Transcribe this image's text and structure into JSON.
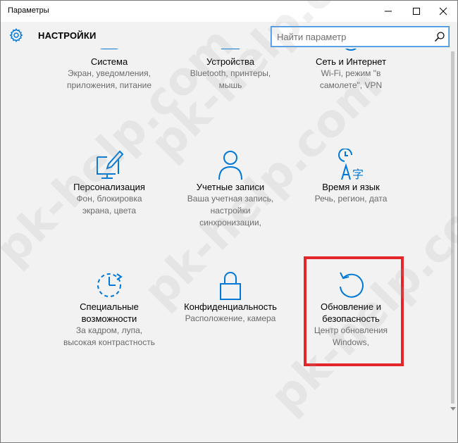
{
  "window": {
    "title": "Параметры"
  },
  "header": {
    "title": "НАСТРОЙКИ"
  },
  "search": {
    "placeholder": "Найти параметр"
  },
  "tiles": [
    {
      "name": "Система",
      "desc_lines": [
        "Экран, уведомления,",
        "приложения, питание"
      ],
      "icon": "system-icon"
    },
    {
      "name": "Устройства",
      "desc_lines": [
        "Bluetooth, принтеры,",
        "мышь"
      ],
      "icon": "devices-icon"
    },
    {
      "name": "Сеть и Интернет",
      "desc_lines": [
        "Wi-Fi, режим \"в",
        "самолете\", VPN"
      ],
      "icon": "network-icon"
    },
    {
      "name": "Персонализация",
      "desc_lines": [
        "Фон, блокировка",
        "экрана, цвета"
      ],
      "icon": "personalization-icon"
    },
    {
      "name": "Учетные записи",
      "desc_lines": [
        "Ваша учетная запись,",
        "настройки",
        "синхронизации,"
      ],
      "icon": "accounts-icon"
    },
    {
      "name": "Время и язык",
      "desc_lines": [
        "Речь, регион, дата"
      ],
      "icon": "time-language-icon"
    },
    {
      "name_lines": [
        "Специальные",
        "возможности"
      ],
      "desc_lines": [
        "За кадром, лупа,",
        "высокая контрастность"
      ],
      "icon": "ease-of-access-icon"
    },
    {
      "name": "Конфиденциальность",
      "desc_lines": [
        "Расположение, камера"
      ],
      "icon": "lock-icon"
    },
    {
      "name_lines": [
        "Обновление и",
        "безопасность"
      ],
      "desc_lines": [
        "Центр обновления",
        "Windows,"
      ],
      "icon": "update-icon"
    }
  ],
  "watermark": {
    "text": "pk-help.com"
  },
  "colors": {
    "accent": "#0078d7",
    "highlight": "#e2262a",
    "background": "#f2f2f2"
  }
}
